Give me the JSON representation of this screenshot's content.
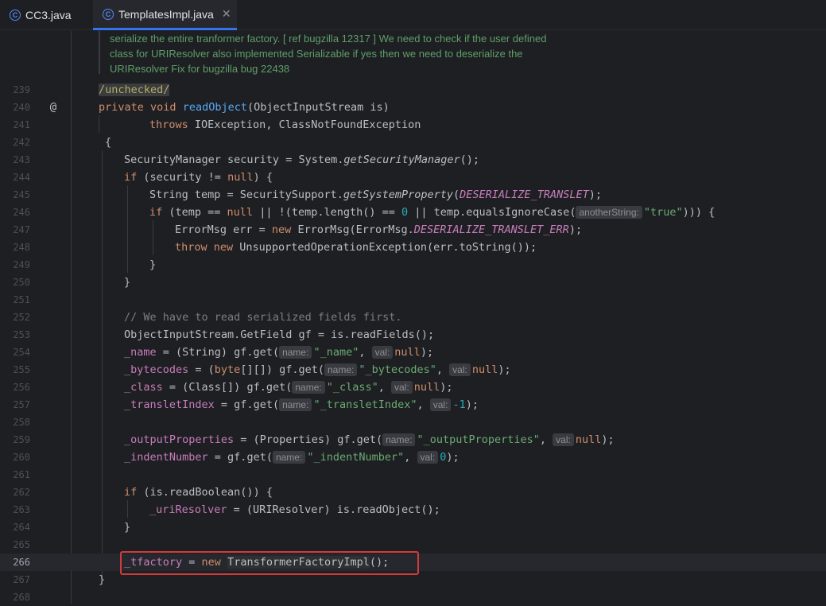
{
  "tabs": [
    {
      "label": "CC3.java",
      "active": false,
      "icon": "class-icon"
    },
    {
      "label": "TemplatesImpl.java",
      "active": true,
      "icon": "class-icon"
    }
  ],
  "doc_comment": [
    "serialize the entire tranformer factory. [ ref bugzilla 12317 ] We need to check if the user defined",
    "class for URIResolver also implemented Serializable if yes then we need to deserialize the",
    "URIResolver Fix for bugzilla bug 22438"
  ],
  "line_numbers": [
    "239",
    "240",
    "241",
    "242",
    "243",
    "244",
    "245",
    "246",
    "247",
    "248",
    "249",
    "250",
    "251",
    "252",
    "253",
    "254",
    "255",
    "256",
    "257",
    "258",
    "259",
    "260",
    "261",
    "262",
    "263",
    "264",
    "265",
    "266",
    "267",
    "268"
  ],
  "code": {
    "l239": "/unchecked/",
    "l240_kw": "private void",
    "l240_fn": "readObject",
    "l240_rest": "(ObjectInputStream is)",
    "l241_kw": "throws",
    "l241_rest": " IOException, ClassNotFoundException",
    "l242": "{",
    "l243_a": "SecurityManager security = System.",
    "l243_b": "getSecurityManager",
    "l243_c": "();",
    "l244_kw": "if",
    "l244_a": " (security != ",
    "l244_null": "null",
    "l244_b": ") {",
    "l245_a": "String temp = SecuritySupport.",
    "l245_b": "getSystemProperty",
    "l245_c": "(",
    "l245_d": "DESERIALIZE_TRANSLET",
    "l245_e": ");",
    "l246_kw": "if",
    "l246_a": " (temp == ",
    "l246_null": "null",
    "l246_b": " || !(temp.length() == ",
    "l246_num": "0",
    "l246_c": " || temp.equalsIgnoreCase(",
    "l246_hint": "anotherString:",
    "l246_str": "\"true\"",
    "l246_d": "))) {",
    "l247_a": "ErrorMsg err = ",
    "l247_new": "new",
    "l247_b": " ErrorMsg(ErrorMsg.",
    "l247_c": "DESERIALIZE_TRANSLET_ERR",
    "l247_d": ");",
    "l248_kw": "throw new",
    "l248_a": " UnsupportedOperationException(err.toString());",
    "l249": "}",
    "l250": "}",
    "l252": "// We have to read serialized fields first.",
    "l253": "ObjectInputStream.GetField gf = is.readFields();",
    "l254_f": "_name",
    "l254_a": " = (String) gf.get(",
    "l254_h1": "name:",
    "l254_s": "\"_name\"",
    "l254_b": ", ",
    "l254_h2": "val:",
    "l254_null": "null",
    "l254_c": ");",
    "l255_f": "_bytecodes",
    "l255_a": " = (",
    "l255_kw": "byte",
    "l255_b": "[][]) gf.get(",
    "l255_h1": "name:",
    "l255_s": "\"_bytecodes\"",
    "l255_c": ", ",
    "l255_h2": "val:",
    "l255_null": "null",
    "l255_d": ");",
    "l256_f": "_class",
    "l256_a": " = (Class[]) gf.get(",
    "l256_h1": "name:",
    "l256_s": "\"_class\"",
    "l256_b": ", ",
    "l256_h2": "val:",
    "l256_null": "null",
    "l256_c": ");",
    "l257_f": "_transletIndex",
    "l257_a": " = gf.get(",
    "l257_h1": "name:",
    "l257_s": "\"_transletIndex\"",
    "l257_b": ", ",
    "l257_h2": "val:",
    "l257_num": "-1",
    "l257_c": ");",
    "l259_f": "_outputProperties",
    "l259_a": " = (Properties) gf.get(",
    "l259_h1": "name:",
    "l259_s": "\"_outputProperties\"",
    "l259_b": ", ",
    "l259_h2": "val:",
    "l259_null": "null",
    "l259_c": ");",
    "l260_f": "_indentNumber",
    "l260_a": " = gf.get(",
    "l260_h1": "name:",
    "l260_s": "\"_indentNumber\"",
    "l260_b": ", ",
    "l260_h2": "val:",
    "l260_num": "0",
    "l260_c": ");",
    "l262_kw": "if",
    "l262_a": " (is.readBoolean()) {",
    "l263_f": "_uriResolver",
    "l263_a": " = (URIResolver) is.readObject();",
    "l264": "}",
    "l266_f": "_tfactory",
    "l266_a": " = ",
    "l266_new": "new",
    "l266_b": " ",
    "l266_cls": "TransformerFactoryImpl",
    "l266_c": "();",
    "l267": "}"
  },
  "colors": {
    "accent": "#3574f0",
    "highlight_border": "#d23b3b"
  }
}
